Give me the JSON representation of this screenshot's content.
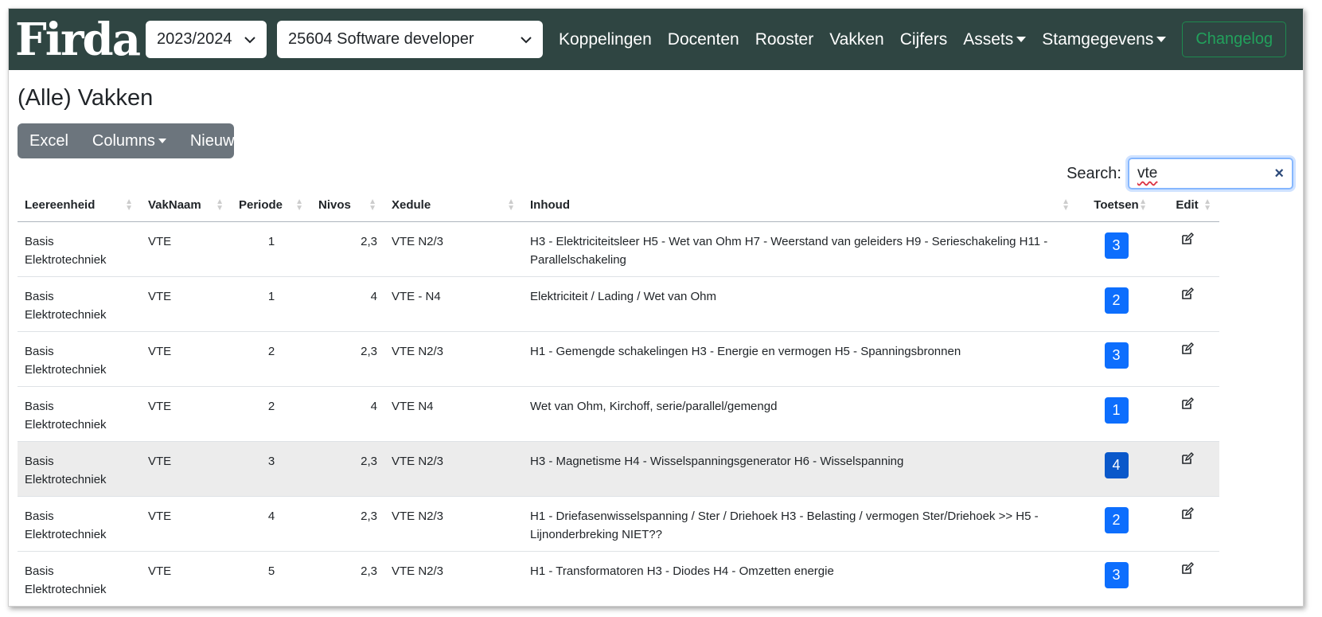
{
  "brand": {
    "logo_text": "Firda"
  },
  "selectors": {
    "year": "2023/2024",
    "course": "25604 Software developer"
  },
  "nav": {
    "links": [
      "Koppelingen",
      "Docenten",
      "Rooster",
      "Vakken",
      "Cijfers"
    ],
    "assets": "Assets",
    "stamgegevens": "Stamgegevens",
    "changelog": "Changelog"
  },
  "page": {
    "title": "(Alle) Vakken"
  },
  "toolbar": {
    "excel": "Excel",
    "columns": "Columns",
    "new": "Nieuw"
  },
  "search": {
    "label": "Search:",
    "value": "vte",
    "clear": "×"
  },
  "table": {
    "headers": [
      "Leereenheid",
      "VakNaam",
      "Periode",
      "Nivos",
      "Xedule",
      "Inhoud",
      "Toetsen",
      "Edit"
    ],
    "rows": [
      {
        "leereenheid": "Basis Elektrotechniek",
        "vaknaam": "VTE",
        "periode": "1",
        "nivos": "2,3",
        "xedule": "VTE N2/3",
        "inhoud": "H3 - Elektriciteitsleer H5 - Wet van Ohm H7 - Weerstand van geleiders H9 - Serieschakeling H11 - Parallelschakeling",
        "toetsen": "3"
      },
      {
        "leereenheid": "Basis Elektrotechniek",
        "vaknaam": "VTE",
        "periode": "1",
        "nivos": "4",
        "xedule": "VTE - N4",
        "inhoud": "Elektriciteit / Lading / Wet van Ohm",
        "toetsen": "2"
      },
      {
        "leereenheid": "Basis Elektrotechniek",
        "vaknaam": "VTE",
        "periode": "2",
        "nivos": "2,3",
        "xedule": "VTE N2/3",
        "inhoud": "H1 - Gemengde schakelingen H3 - Energie en vermogen H5 - Spanningsbronnen",
        "toetsen": "3"
      },
      {
        "leereenheid": "Basis Elektrotechniek",
        "vaknaam": "VTE",
        "periode": "2",
        "nivos": "4",
        "xedule": "VTE N4",
        "inhoud": "Wet van Ohm, Kirchoff, serie/parallel/gemengd",
        "toetsen": "1"
      },
      {
        "leereenheid": "Basis Elektrotechniek",
        "vaknaam": "VTE",
        "periode": "3",
        "nivos": "2,3",
        "xedule": "VTE N2/3",
        "inhoud": "H3 - Magnetisme H4 - Wisselspanningsgenerator H6 - Wisselspanning",
        "toetsen": "4"
      },
      {
        "leereenheid": "Basis Elektrotechniek",
        "vaknaam": "VTE",
        "periode": "4",
        "nivos": "2,3",
        "xedule": "VTE N2/3",
        "inhoud": "H1 - Driefasenwisselspanning / Ster / Driehoek H3 - Belasting / vermogen Ster/Driehoek >> H5 - Lijnonderbreking NIET??",
        "toetsen": "2"
      },
      {
        "leereenheid": "Basis Elektrotechniek",
        "vaknaam": "VTE",
        "periode": "5",
        "nivos": "2,3",
        "xedule": "VTE N2/3",
        "inhoud": "H1 - Transformatoren H3 - Diodes H4 - Omzetten energie",
        "toetsen": "3"
      }
    ]
  },
  "colors": {
    "navbar": "#2f4542",
    "badge": "#0d6efd",
    "button_group": "#6c757d",
    "changelog": "#22a15c"
  }
}
